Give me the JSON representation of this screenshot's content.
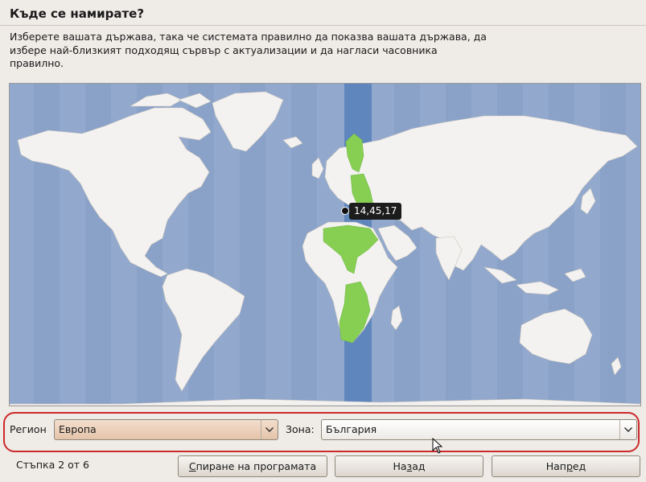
{
  "header": {
    "title": "Къде се намирате?",
    "description": "Изберете вашата държава, така че системата правилно да показва вашата държава, да избере най-близкият подходящ сървър с актуализации и да нагласи часовника правилно."
  },
  "map": {
    "tooltip": "14,45,17",
    "highlight_color": "#86cf53",
    "ocean_color": "#92a9cd",
    "selected_band_color": "#5f86bd",
    "land_color": "#f4f2f0"
  },
  "selectors": {
    "region_label": "Регион",
    "region_value": "Европа",
    "zone_label": "Зона:",
    "zone_value": "България",
    "ring_color": "#cc2a2a"
  },
  "footer": {
    "step": "Стъпка 2 от 6",
    "quit_button": {
      "mnemonic": "С",
      "rest": "пиране на програмата"
    },
    "back_button": {
      "pre": "На",
      "mnemonic": "з",
      "post": "ад"
    },
    "forward_button": {
      "pre": "Нап",
      "mnemonic": "р",
      "post": "ед"
    }
  }
}
